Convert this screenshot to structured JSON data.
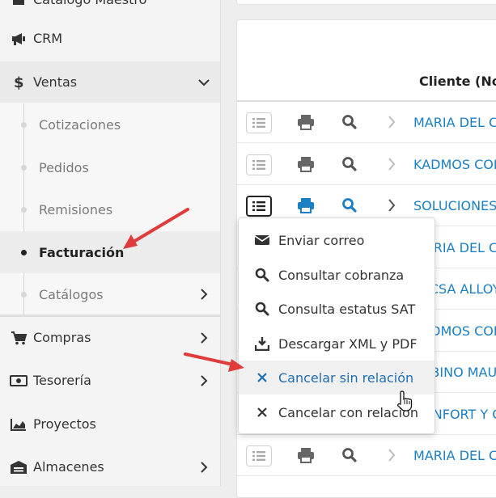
{
  "sidebar": {
    "items": [
      {
        "label": "Catálogo Maestro",
        "icon": "book-icon"
      },
      {
        "label": "CRM",
        "icon": "megaphone-icon"
      },
      {
        "label": "Ventas",
        "icon": "dollar-icon"
      },
      {
        "label": "Compras",
        "icon": "cart-icon"
      },
      {
        "label": "Tesorería",
        "icon": "money-icon"
      },
      {
        "label": "Proyectos",
        "icon": "area-chart-icon"
      },
      {
        "label": "Almacenes",
        "icon": "warehouse-icon"
      }
    ],
    "ventas_submenu": [
      {
        "label": "Cotizaciones"
      },
      {
        "label": "Pedidos"
      },
      {
        "label": "Remisiones"
      },
      {
        "label": "Facturación",
        "active": true
      },
      {
        "label": "Catálogos"
      }
    ]
  },
  "table": {
    "column_header": "Cliente (Nombre)",
    "rows": [
      {
        "client": "MARIA DEL CARMEN"
      },
      {
        "client": "KADMOS CORP"
      },
      {
        "client": "SOLUCIONES"
      },
      {
        "client": "MARIA DEL CARMEN"
      },
      {
        "client": "ALCSA ALLOYS"
      },
      {
        "client": "KADMOS CORP"
      },
      {
        "client": "SABINO MAULEON"
      },
      {
        "client": "CONFORT Y CALIDAD"
      },
      {
        "client": "MARIA DEL CARMEN"
      }
    ]
  },
  "dropdown": {
    "items": [
      {
        "label": "Enviar correo",
        "icon": "envelope-icon"
      },
      {
        "label": "Consultar cobranza",
        "icon": "search-icon"
      },
      {
        "label": "Consulta estatus SAT",
        "icon": "search-icon"
      },
      {
        "label": "Descargar XML y PDF",
        "icon": "download-icon"
      },
      {
        "label": "Cancelar sin relación",
        "icon": "times-icon",
        "highlighted": true
      },
      {
        "label": "Cancelar con relación",
        "icon": "times-icon"
      }
    ]
  },
  "colors": {
    "link_blue": "#1b7fc4",
    "highlight_blue": "#1f6fb5",
    "annotation_red": "#e03c3c"
  }
}
